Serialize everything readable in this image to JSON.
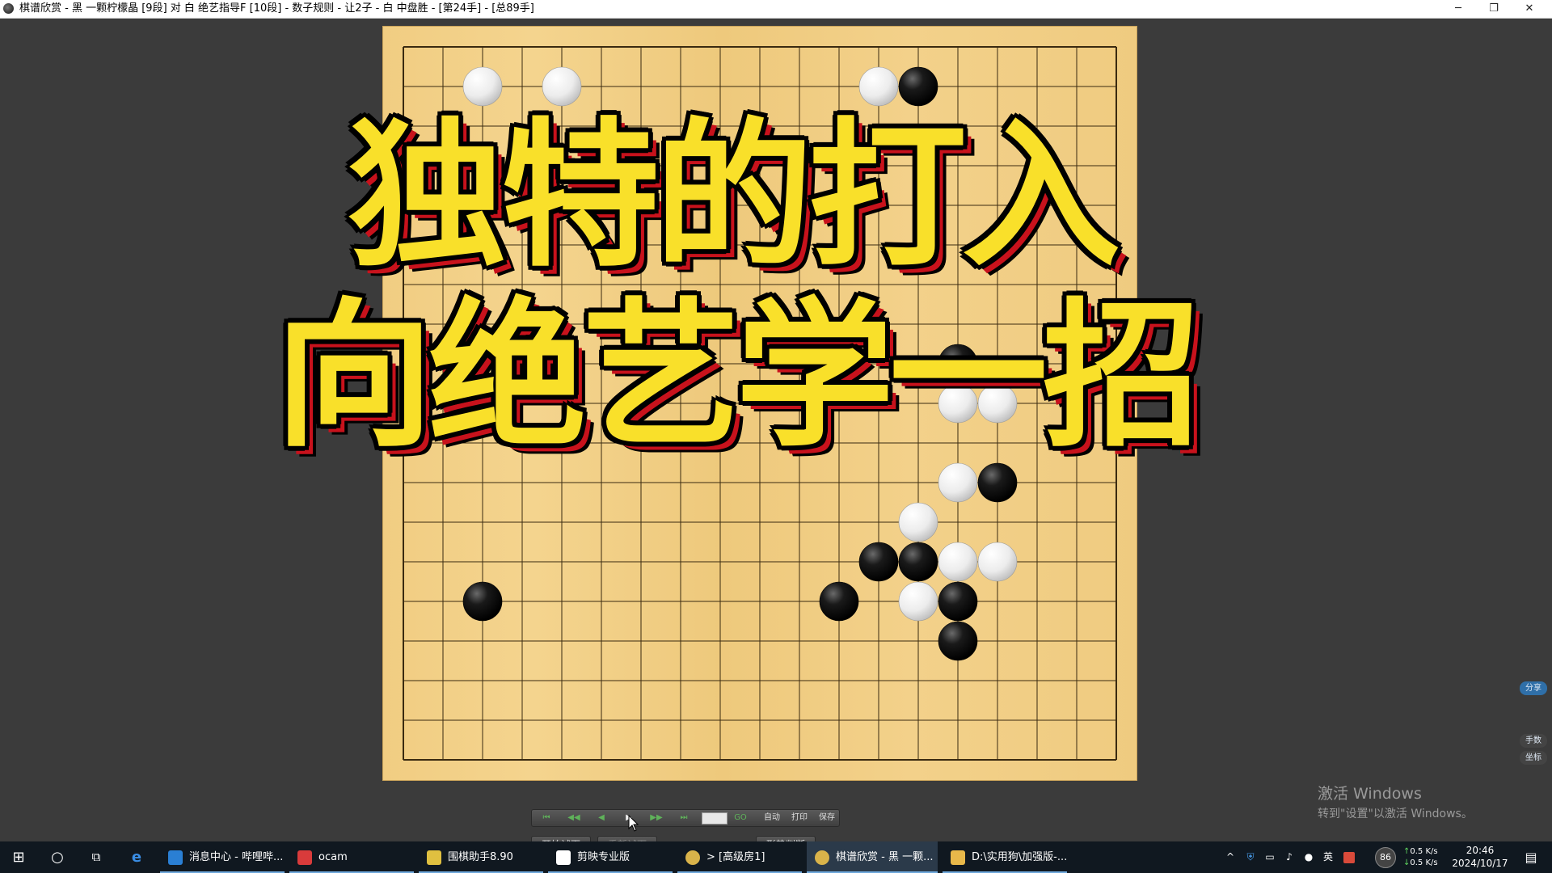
{
  "window": {
    "title": "棋谱欣赏 - 黑 一颗柠檬晶 [9段] 对 白 绝艺指导F [10段] - 数子规则 - 让2子 - 白 中盘胜 - [第24手] - [总89手]",
    "minimize": "─",
    "restore": "❐",
    "close": "✕"
  },
  "overlay": {
    "line1": "独特的打入",
    "line2": "向绝艺学一招"
  },
  "board": {
    "size": 19,
    "star_points": [
      [
        15,
        9
      ]
    ],
    "stones": [
      {
        "color": "white",
        "col": 3,
        "row": 2
      },
      {
        "color": "white",
        "col": 5,
        "row": 2
      },
      {
        "color": "white",
        "col": 13,
        "row": 2
      },
      {
        "color": "black",
        "col": 14,
        "row": 2
      },
      {
        "color": "black",
        "col": 15,
        "row": 9
      },
      {
        "color": "white",
        "col": 15,
        "row": 10
      },
      {
        "color": "white",
        "col": 16,
        "row": 10
      },
      {
        "color": "white",
        "col": 15,
        "row": 12
      },
      {
        "color": "black",
        "col": 16,
        "row": 12
      },
      {
        "color": "white",
        "col": 14,
        "row": 13
      },
      {
        "color": "black",
        "col": 13,
        "row": 14
      },
      {
        "color": "black",
        "col": 14,
        "row": 14
      },
      {
        "color": "white",
        "col": 15,
        "row": 14
      },
      {
        "color": "white",
        "col": 16,
        "row": 14
      },
      {
        "color": "black",
        "col": 3,
        "row": 15
      },
      {
        "color": "black",
        "col": 12,
        "row": 15
      },
      {
        "color": "white",
        "col": 14,
        "row": 15
      },
      {
        "color": "black",
        "col": 15,
        "row": 15
      },
      {
        "color": "black",
        "col": 15,
        "row": 16
      }
    ]
  },
  "controls": {
    "first": "⏮",
    "fast_back": "◀◀",
    "back": "◀",
    "play": "▶",
    "fast_forward": "▶▶",
    "last": "⏭",
    "go": "GO",
    "auto": "自动",
    "print": "打印",
    "save": "保存",
    "try_move": "开始试下",
    "retry": "重新试下",
    "judge": "形势判断"
  },
  "side_panel": {
    "share": "分享",
    "move_numbers": "手数",
    "coordinates": "坐标"
  },
  "watermark": {
    "line1": "激活 Windows",
    "line2": "转到\"设置\"以激活 Windows。"
  },
  "taskbar": {
    "start_icon": "windows-icon",
    "search_icon": "search-circle-icon",
    "taskview_icon": "task-view-icon",
    "ie_icon": "ie-icon",
    "tasks": [
      {
        "label": "消息中心 - 哔哩哔...",
        "color": "#2a7fd4"
      },
      {
        "label": "ocam",
        "color": "#d93b3b"
      },
      {
        "label": "围棋助手8.90",
        "color": "#e0c040"
      },
      {
        "label": "剪映专业版",
        "color": "#ffffff"
      },
      {
        "label": "> [高级房1]",
        "color": "#d9b34a"
      },
      {
        "label": "棋谱欣赏 - 黑 一颗...",
        "color": "#d9b34a"
      },
      {
        "label": "D:\\实用狗\\加强版-...",
        "color": "#e8b84a"
      }
    ],
    "tray": {
      "chevron": "^",
      "ime": "英",
      "battery": "86",
      "net_up": "0.5",
      "net_down": "0.5",
      "net_unit": "K/s",
      "time": "20:46",
      "date": "2024/10/17"
    }
  }
}
